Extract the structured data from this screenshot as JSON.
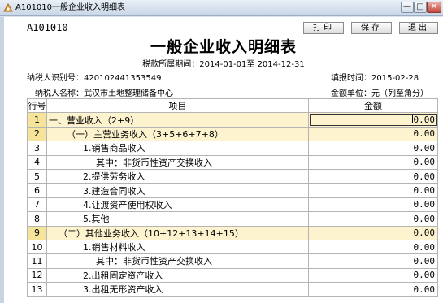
{
  "window": {
    "title": "A101010一般企业收入明细表",
    "min_label": "—",
    "max_label": "□",
    "close_label": "✕"
  },
  "toolbar": {
    "report_code": "A101010",
    "print_label": "打印",
    "save_label": "保存",
    "exit_label": "退出"
  },
  "report": {
    "title": "一般企业收入明细表",
    "period": "税款所属期间：2014-01-01至 2014-12-31",
    "taxpayer_id_label": "纳税人识别号：",
    "taxpayer_id": "420102441353549",
    "fill_date_label": "填报时间：",
    "fill_date": "2015-02-28",
    "taxpayer_name_label": "纳税人名称：",
    "taxpayer_name": "武汉市土地整理储备中心",
    "unit": "金额单位：元（列至角分）"
  },
  "table": {
    "headers": [
      "行号",
      "项目",
      "金额"
    ],
    "rows": [
      {
        "no": "1",
        "item": "一、营业收入（2+9）",
        "amount": "0.00"
      },
      {
        "no": "2",
        "item": "（一）主营业务收入（3+5+6+7+8）",
        "amount": "0.00"
      },
      {
        "no": "3",
        "item": "1.销售商品收入",
        "amount": "0.00"
      },
      {
        "no": "4",
        "item": "其中：非货币性资产交换收入",
        "amount": "0.00"
      },
      {
        "no": "5",
        "item": "2.提供劳务收入",
        "amount": "0.00"
      },
      {
        "no": "6",
        "item": "3.建造合同收入",
        "amount": "0.00"
      },
      {
        "no": "7",
        "item": "4.让渡资产使用权收入",
        "amount": "0.00"
      },
      {
        "no": "8",
        "item": "5.其他",
        "amount": "0.00"
      },
      {
        "no": "9",
        "item": "（二）其他业务收入（10+12+13+14+15）",
        "amount": "0.00"
      },
      {
        "no": "10",
        "item": "1.销售材料收入",
        "amount": "0.00"
      },
      {
        "no": "11",
        "item": "其中：非货币性资产交换收入",
        "amount": "0.00"
      },
      {
        "no": "12",
        "item": "2.出租固定资产收入",
        "amount": "0.00"
      },
      {
        "no": "13",
        "item": "3.出租无形资产收入",
        "amount": "0.00"
      }
    ]
  },
  "colors": {
    "highlight_row": "#fdf3cf",
    "highlight_no": "#f6e49a",
    "titlebar": "#c9d6e6"
  }
}
